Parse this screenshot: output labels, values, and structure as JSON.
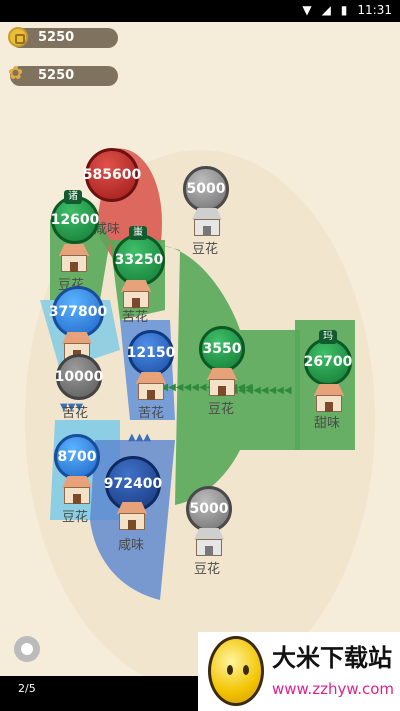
{
  "status": {
    "time": "11:31"
  },
  "resources": {
    "gold": "5250",
    "grain": "5250"
  },
  "icons": {
    "gold": "coin-icon",
    "grain": "wheat-icon"
  },
  "colors": {
    "red": "#c62828",
    "green": "#2e8b3e",
    "blue": "#2b6cc4",
    "gray": "#6e6e6e"
  },
  "nodes": [
    {
      "id": "n1",
      "value": "585600",
      "owner": "red"
    },
    {
      "id": "n2",
      "value": "12600",
      "owner": "green",
      "tag": "诸",
      "label": "豆花"
    },
    {
      "id": "n3",
      "value": "33250",
      "owner": "green",
      "tag": "蚩",
      "label": "苦花"
    },
    {
      "id": "n4",
      "value": "377800",
      "owner": "blue"
    },
    {
      "id": "n5",
      "value": "12150",
      "owner": "blue",
      "label": "苦花"
    },
    {
      "id": "n6",
      "value": "10000",
      "owner": "gray",
      "label": "苦花"
    },
    {
      "id": "n7",
      "value": "8700",
      "owner": "blue",
      "label": "豆花"
    },
    {
      "id": "n8",
      "value": "972400",
      "owner": "blue",
      "label": "咸味"
    },
    {
      "id": "n9",
      "value": "3550",
      "owner": "green",
      "label": "豆花"
    },
    {
      "id": "n10",
      "value": "26700",
      "owner": "green",
      "tag": "玛",
      "label": "甜味"
    },
    {
      "id": "n11",
      "value": "5000",
      "owner": "gray",
      "label": "豆花"
    },
    {
      "id": "n12",
      "value": "5000",
      "owner": "gray",
      "label": "豆花"
    }
  ],
  "n1_label": "咸味",
  "page_indicator": "2/5",
  "watermark": {
    "title": "大米下载站",
    "url": "www.zzhyw.com"
  }
}
